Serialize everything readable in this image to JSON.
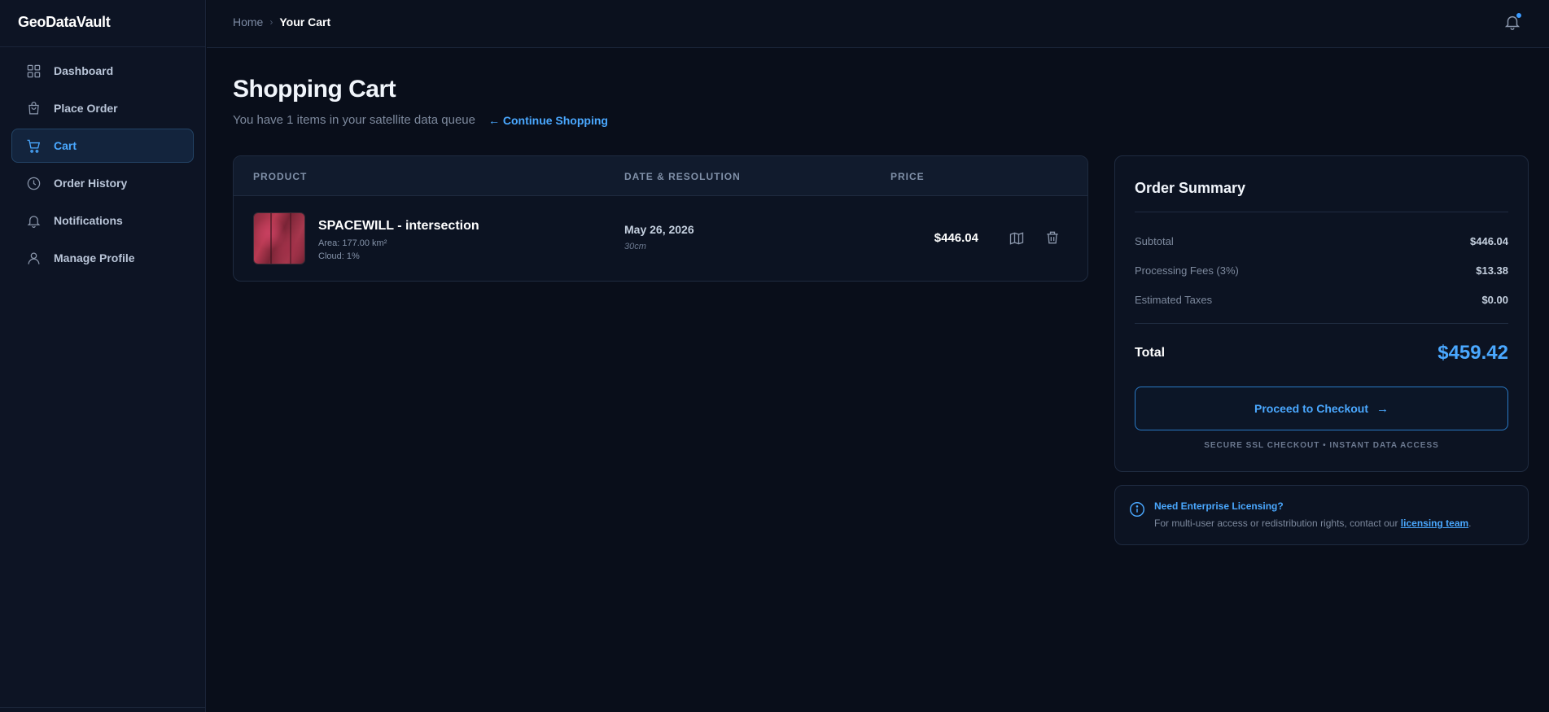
{
  "app": {
    "logo": "GeoDataVault"
  },
  "sidebar": {
    "items": [
      {
        "label": "Dashboard",
        "icon": "grid-icon"
      },
      {
        "label": "Place Order",
        "icon": "bag-icon"
      },
      {
        "label": "Cart",
        "icon": "cart-icon",
        "active": true
      },
      {
        "label": "Order History",
        "icon": "clock-icon"
      },
      {
        "label": "Notifications",
        "icon": "bell-icon"
      },
      {
        "label": "Manage Profile",
        "icon": "user-icon"
      }
    ]
  },
  "breadcrumb": {
    "home": "Home",
    "separator": "›",
    "current": "Your Cart"
  },
  "header": {
    "title": "Shopping Cart",
    "subtitle": "You have 1 items in your satellite data queue",
    "continue_link": "← Continue Shopping"
  },
  "cart": {
    "columns": {
      "product": "PRODUCT",
      "date": "DATE & RESOLUTION",
      "price": "PRICE"
    },
    "items": [
      {
        "name": "SPACEWILL - intersection",
        "area": "Area: 177.00 km²",
        "cloud": "Cloud: 1%",
        "date": "May 26, 2026",
        "resolution": "30cm",
        "price": "$446.04"
      }
    ]
  },
  "summary": {
    "title": "Order Summary",
    "subtotal_label": "Subtotal",
    "subtotal_value": "$446.04",
    "fees_label": "Processing Fees (3%)",
    "fees_value": "$13.38",
    "taxes_label": "Estimated Taxes",
    "taxes_value": "$0.00",
    "total_label": "Total",
    "total_value": "$459.42",
    "checkout_label": "Proceed to Checkout",
    "secure_note": "SECURE SSL CHECKOUT • INSTANT DATA ACCESS"
  },
  "enterprise": {
    "title": "Need Enterprise Licensing?",
    "text": "For multi-user access or redistribution rights, contact our",
    "link": "licensing team",
    "suffix": "."
  },
  "colors": {
    "accent": "#4aa8ff",
    "background": "#090e1a",
    "panel": "#0c1322"
  }
}
